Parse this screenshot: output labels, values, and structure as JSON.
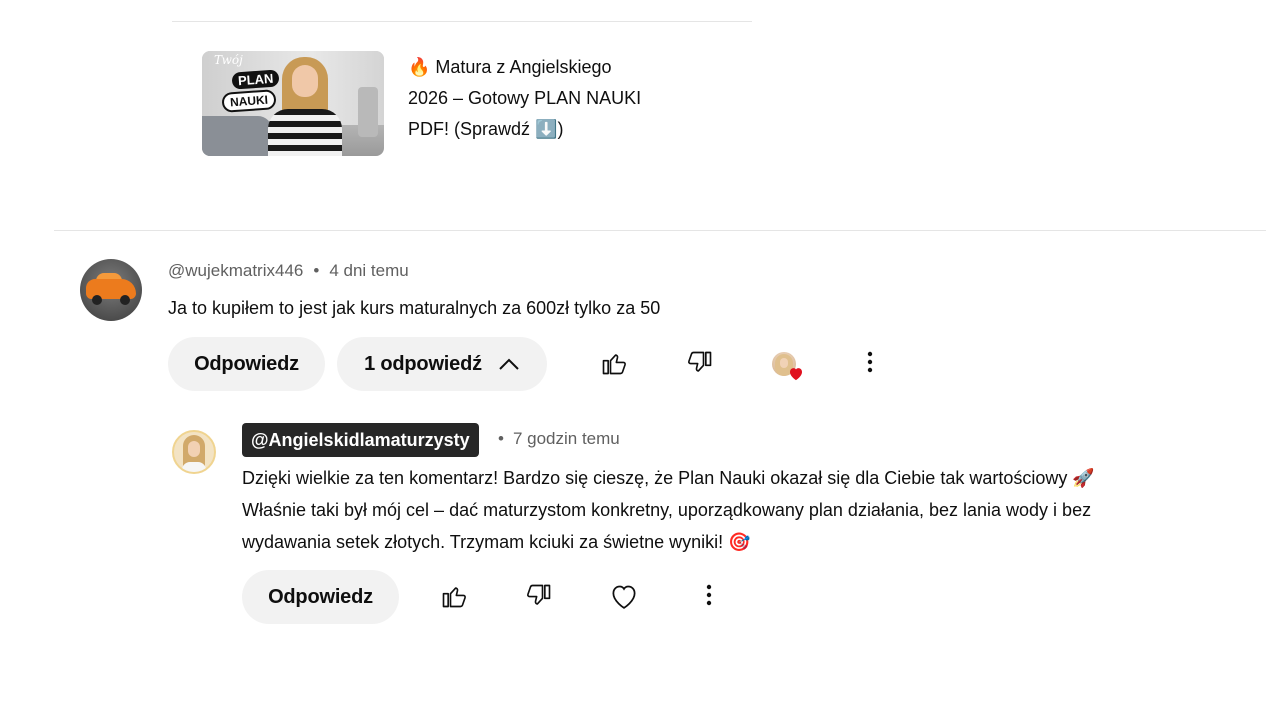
{
  "video": {
    "title_line1": "🔥 Matura z Angielskiego",
    "title_line2": "2026 – Gotowy PLAN NAUKI",
    "title_line3": "PDF! (Sprawdź ⬇️)",
    "thumb_text_tvoj": "Twój",
    "thumb_text_plan": "PLAN",
    "thumb_text_nauki": "NAUKI"
  },
  "comment": {
    "author": "@wujekmatrix446",
    "time": "4 dni temu",
    "text": "Ja to kupiłem to jest jak kurs maturalnych za 600zł tylko za 50",
    "reply_button": "Odpowiedz",
    "replies_button": "1 odpowiedź"
  },
  "reply": {
    "author": "@Angielskidlamaturzysty",
    "time": "7 godzin temu",
    "line1": "Dzięki wielkie za ten komentarz! Bardzo się cieszę, że Plan Nauki okazał się dla Ciebie tak wartościowy 🚀",
    "line2": "Właśnie taki był mój cel – dać maturzystom konkretny, uporządkowany plan działania, bez lania wody i bez",
    "line3": "wydawania setek złotych. Trzymam kciuki za świetne wyniki! 🎯",
    "reply_button": "Odpowiedz"
  },
  "icons": [
    "thumb-up-icon",
    "thumb-down-icon",
    "heart-icon",
    "more-vert-icon",
    "chevron-up-icon"
  ],
  "colors": {
    "chip_bg": "#272727",
    "pill_bg": "#f2f2f2",
    "heart_red": "#e0101e",
    "meta_gray": "#606060"
  }
}
